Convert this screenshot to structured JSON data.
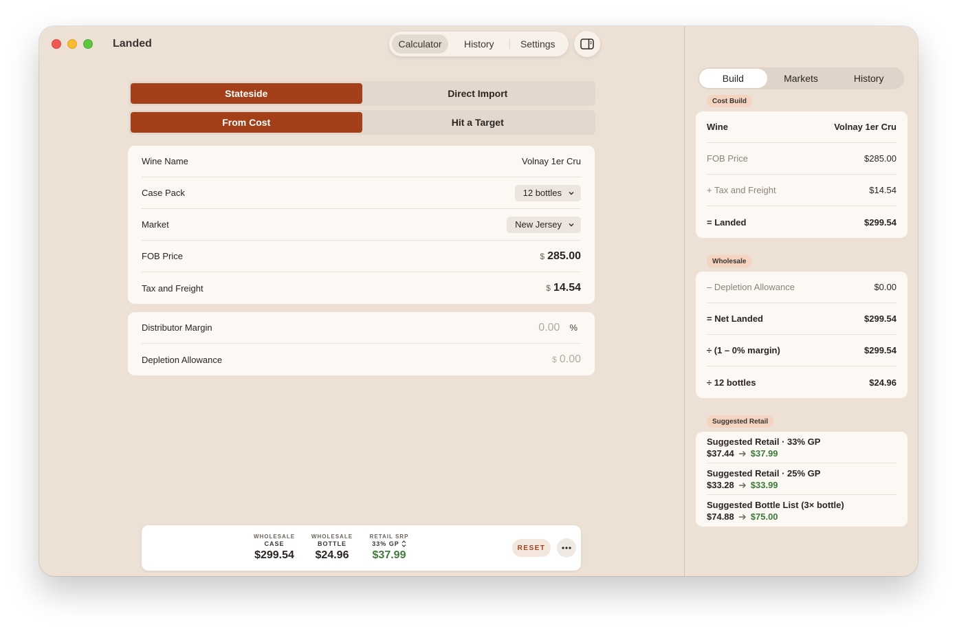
{
  "window": {
    "title": "Landed"
  },
  "top_tabs": [
    "Calculator",
    "History",
    "Settings"
  ],
  "mode": {
    "sourcing": [
      "Stateside",
      "Direct Import"
    ],
    "calc": [
      "From Cost",
      "Hit a Target"
    ]
  },
  "form": {
    "wine_name_label": "Wine Name",
    "wine_name_value": "Volnay 1er Cru",
    "case_pack_label": "Case Pack",
    "case_pack_value": "12 bottles",
    "market_label": "Market",
    "market_value": "New Jersey",
    "fob_label": "FOB Price",
    "fob_currency": "$",
    "fob_value": "285.00",
    "tax_label": "Tax and Freight",
    "tax_currency": "$",
    "tax_value": "14.54"
  },
  "form2": {
    "margin_label": "Distributor Margin",
    "margin_value": "0.00",
    "margin_symbol": "%",
    "depletion_label": "Depletion Allowance",
    "depletion_currency": "$",
    "depletion_value": "0.00"
  },
  "bottom_bar": {
    "case": {
      "k1": "WHOLESALE",
      "k2": "CASE",
      "value": "$299.54"
    },
    "bottle": {
      "k1": "WHOLESALE",
      "k2": "BOTTLE",
      "value": "$24.96"
    },
    "retail": {
      "k1": "RETAIL SRP",
      "k2": "33% GP",
      "value": "$37.99"
    },
    "reset_label": "RESET"
  },
  "right_tabs": [
    "Build",
    "Markets",
    "History"
  ],
  "cost_build": {
    "pill": "Cost Build",
    "rows": [
      {
        "label": "Wine",
        "value": "Volnay 1er Cru"
      },
      {
        "label": "FOB Price",
        "value": "$285.00"
      },
      {
        "label": "+ Tax and Freight",
        "value": "$14.54"
      },
      {
        "label": "= Landed",
        "value": "$299.54"
      }
    ]
  },
  "wholesale": {
    "pill": "Wholesale",
    "rows": [
      {
        "label": "– Depletion Allowance",
        "value": "$0.00"
      },
      {
        "label": "= Net Landed",
        "value": "$299.54"
      },
      {
        "label": "÷ (1 – 0% margin)",
        "value": "$299.54"
      },
      {
        "label": "÷ 12 bottles",
        "value": "$24.96"
      }
    ]
  },
  "suggested_retail": {
    "pill": "Suggested Retail",
    "rows": [
      {
        "title": "Suggested Retail · 33% GP",
        "from": "$37.44",
        "to": "$37.99"
      },
      {
        "title": "Suggested Retail · 25% GP",
        "from": "$33.28",
        "to": "$33.99"
      },
      {
        "title": "Suggested Bottle List (3× bottle)",
        "from": "$74.88",
        "to": "$75.00"
      }
    ]
  },
  "colors": {
    "accent": "#a3401a",
    "green": "#3e7a3a",
    "window_bg": "#ede1d6",
    "card_bg": "#fcf8f4"
  }
}
